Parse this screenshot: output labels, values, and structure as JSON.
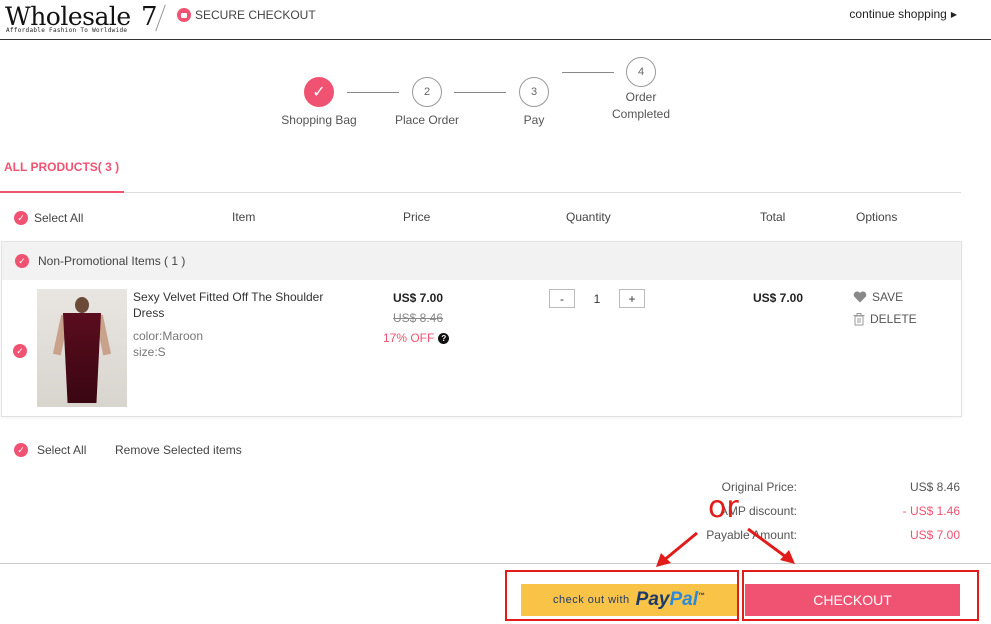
{
  "header": {
    "logo_text": "Wholesale",
    "logo_seven": "7",
    "logo_tagline": "Affordable Fashion To Worldwide",
    "secure_label": "SECURE CHECKOUT",
    "continue_label": "continue shopping"
  },
  "steps": [
    {
      "num": "✓",
      "label": "Shopping Bag"
    },
    {
      "num": "2",
      "label": "Place Order"
    },
    {
      "num": "3",
      "label": "Pay"
    },
    {
      "num": "4",
      "label": "Order\nCompleted"
    }
  ],
  "tabs": {
    "all_products": "ALL PRODUCTS( 3 )"
  },
  "table": {
    "select_all": "Select All",
    "columns": {
      "item": "Item",
      "price": "Price",
      "quantity": "Quantity",
      "total": "Total",
      "options": "Options"
    }
  },
  "group": {
    "title": "Non-Promotional Items ( 1 )",
    "item": {
      "name": "Sexy Velvet Fitted Off The Shoulder Dress",
      "color": "color:Maroon",
      "size": "size:S",
      "price_now": "US$ 7.00",
      "price_old": "US$ 8.46",
      "discount": "17% OFF",
      "qty": "1",
      "qty_minus": "-",
      "qty_plus": "+",
      "total": "US$ 7.00",
      "save_label": "SAVE",
      "delete_label": "DELETE"
    }
  },
  "bottom": {
    "select_all": "Select All",
    "remove_selected": "Remove Selected items"
  },
  "summary": {
    "original_label": "Original Price:",
    "original_value": "US$ 8.46",
    "discount_label": "AMP discount:",
    "discount_value": "- US$ 1.46",
    "payable_label": "Payable Amount:",
    "payable_value": "US$ 7.00"
  },
  "buttons": {
    "paypal_prefix": "check out with",
    "paypal_pay": "Pay",
    "paypal_pal": "Pal",
    "paypal_tm": "™",
    "checkout": "CHECKOUT"
  },
  "annotation": {
    "or_text": "or"
  },
  "colors": {
    "accent": "#f05372",
    "paypal": "#f9c347",
    "annotation": "#e21b1b"
  }
}
